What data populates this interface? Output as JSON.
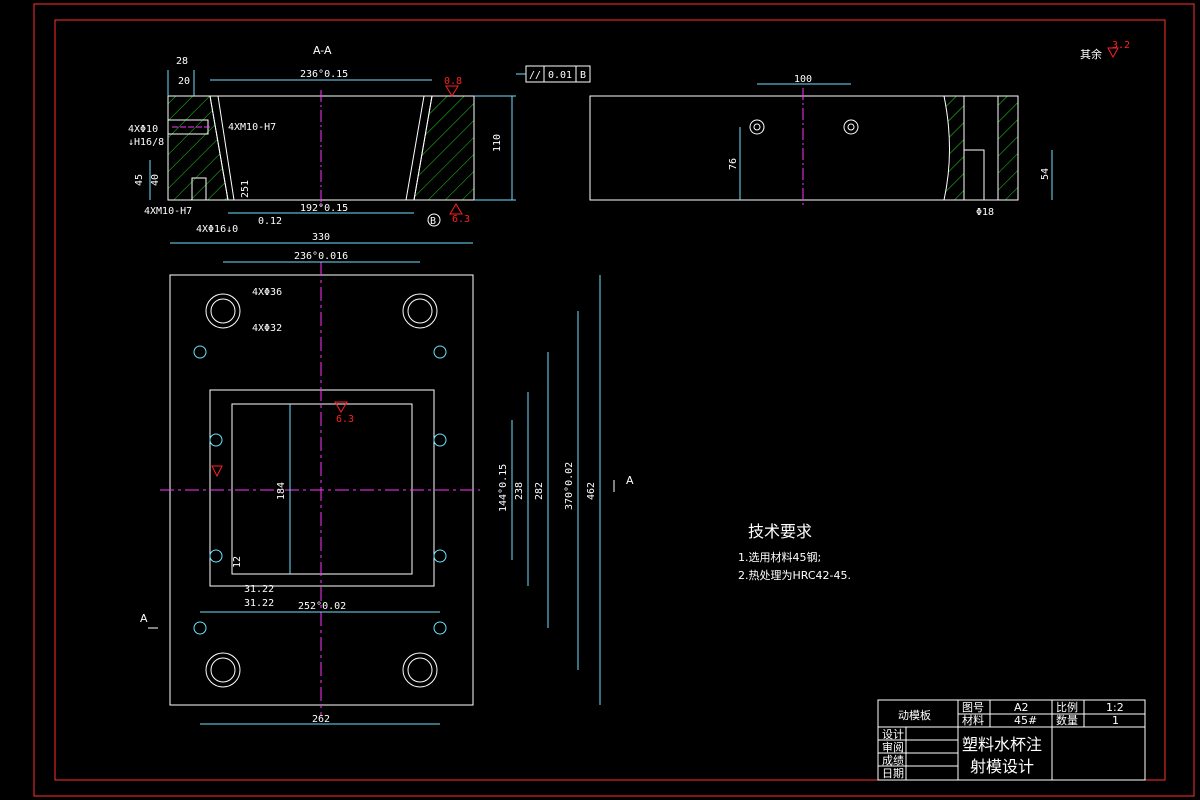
{
  "section_label": "A-A",
  "section_marker": "A",
  "surface_finish_note": "其余",
  "roughness": {
    "main": "0.8",
    "bottom": "6.3",
    "rest": "3.2",
    "plate": "6.3"
  },
  "gdt": {
    "symbol": "//",
    "value": "0.01",
    "datum": "B"
  },
  "datum_b": "B",
  "dims_section": {
    "d28": "28",
    "d20": "20",
    "d236": "236°0.15",
    "d192": "192°0.15",
    "d110": "110",
    "d45": "45",
    "d40": "40",
    "d251": "251",
    "small_012": "0.12",
    "hole1a": "4XΦ10",
    "hole1b": "↓H16/8",
    "thread1": "4XM10-H7",
    "thread2": "4XM10-H7",
    "hole2": "4XΦ16↓0"
  },
  "dims_side": {
    "d100": "100",
    "d76": "76",
    "d54": "54",
    "d18": "Φ18"
  },
  "dims_plan": {
    "d330": "330",
    "d236": "236°0.016",
    "d36": "4XΦ36",
    "d32": "4XΦ32",
    "d184": "184",
    "d144": "144°0.15",
    "d238": "238",
    "d282": "282",
    "d370": "370°0.02",
    "d462": "462",
    "d12": "12",
    "d3122a": "31.22",
    "d3122b": "31.22",
    "d252": "252°0.02",
    "d262": "262"
  },
  "tech": {
    "title": "技术要求",
    "items": [
      "1.选用材料45钢;",
      "2.热处理为HRC42-45."
    ]
  },
  "title_block": {
    "part_name": "动模板",
    "drawing_no_label": "图号",
    "drawing_no": "A2",
    "scale_label": "比例",
    "scale": "1:2",
    "material_label": "材料",
    "material": "45#",
    "qty_label": "数量",
    "qty": "1",
    "roles": [
      "设计",
      "审阅",
      "成绩",
      "日期"
    ],
    "project_line1": "塑料水杯注",
    "project_line2": "射模设计"
  },
  "colors": {
    "outline": "#ffffff",
    "dim": "#6ee0ff",
    "center": "#ff33ff",
    "hatch": "#1fd61f",
    "rough": "#ff2020",
    "hidden": "#6666ff",
    "border": "#ff3030"
  }
}
